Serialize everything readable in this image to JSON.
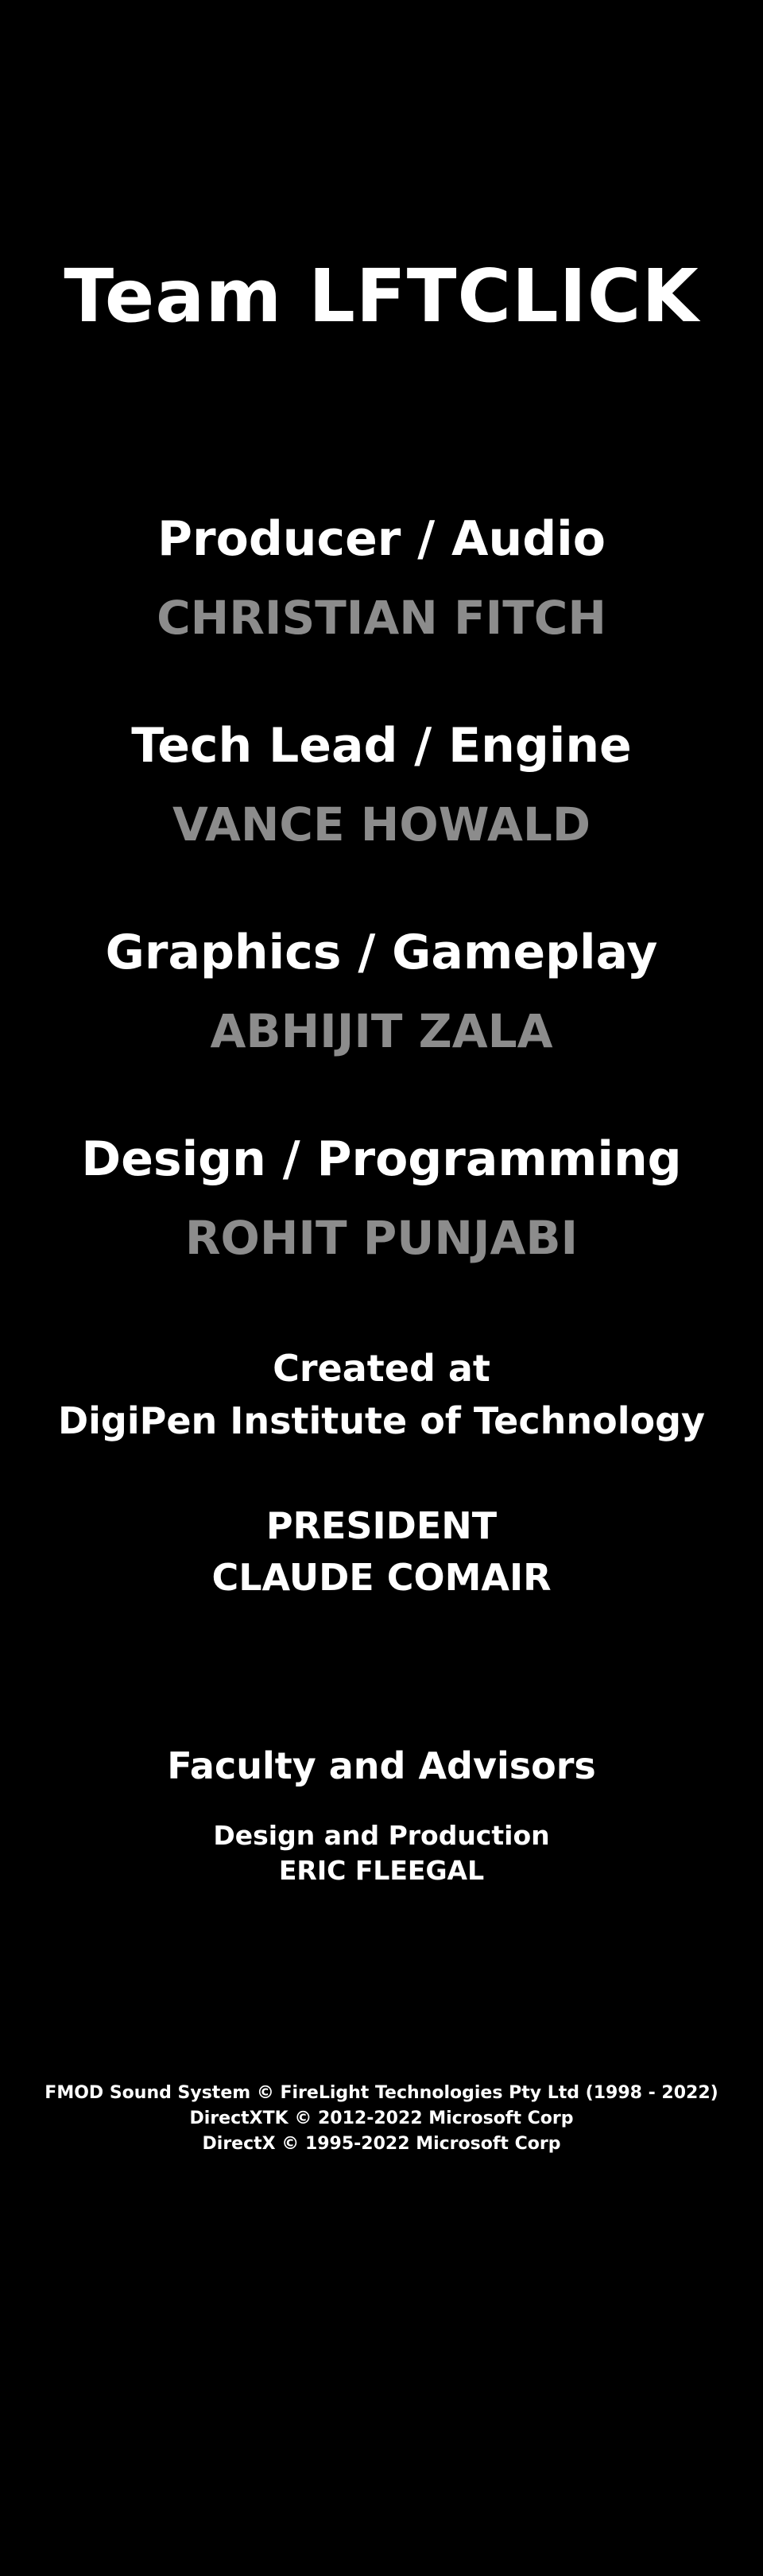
{
  "credits": {
    "title": "Team LFTCLICK",
    "team": [
      {
        "role": "Producer / Audio",
        "name": "CHRISTIAN FITCH"
      },
      {
        "role": "Tech Lead / Engine",
        "name": "VANCE HOWALD"
      },
      {
        "role": "Graphics / Gameplay",
        "name": "ABHIJIT ZALA"
      },
      {
        "role": "Design / Programming",
        "name": "ROHIT PUNJABI"
      }
    ],
    "created_label": "Created at",
    "institution": "DigiPen Institute of Technology",
    "president_label": "PRESIDENT",
    "president_name": "CLAUDE COMAIR",
    "faculty_heading": "Faculty and Advisors",
    "faculty_role": "Design and Production",
    "faculty_name": "ERIC FLEEGAL",
    "legal": [
      "FMOD Sound System © FireLight Technologies Pty Ltd (1998 - 2022)",
      "DirectXTK © 2012-2022 Microsoft Corp",
      "DirectX © 1995-2022 Microsoft Corp"
    ]
  },
  "colors": {
    "background": "#000000",
    "heading_text": "#ffffff",
    "name_text": "#8c8c8c"
  }
}
